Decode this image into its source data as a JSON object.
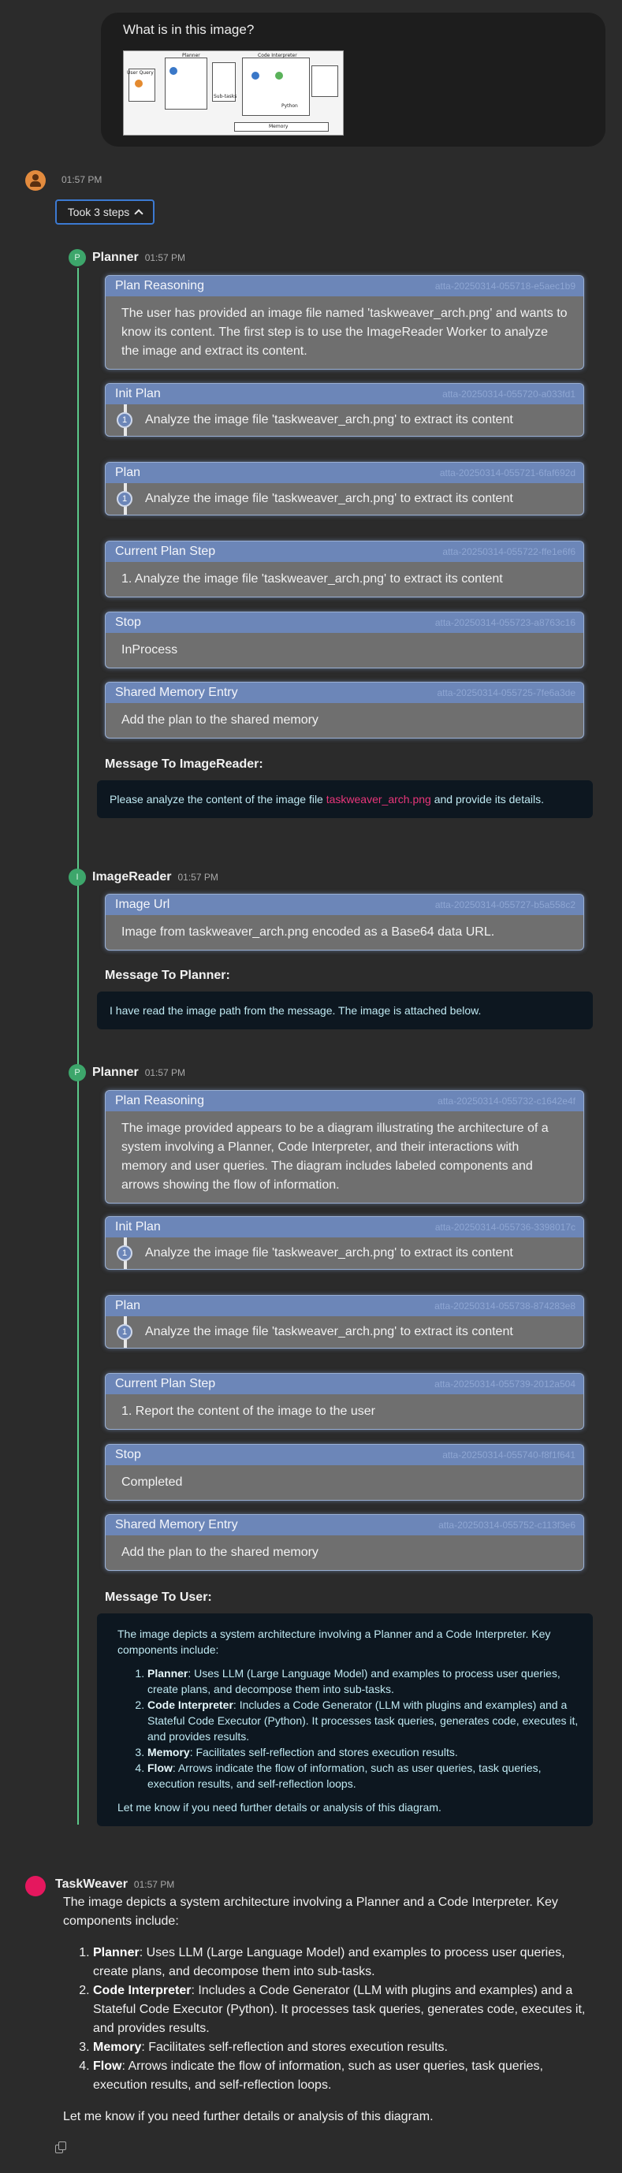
{
  "user_message": {
    "question": "What is in this image?",
    "thumb_labels": [
      "Planner",
      "Code Interpreter",
      "User Query",
      "Memory",
      "Examples",
      "Sub-tasks",
      "Python"
    ]
  },
  "bot": {
    "time": "01:57 PM",
    "steps_button": "Took 3 steps"
  },
  "round1": {
    "planner": {
      "initial": "P",
      "name": "Planner",
      "time": "01:57 PM",
      "cards": [
        {
          "title": "Plan Reasoning",
          "id": "atta-20250314-055718-e5aec1b9",
          "text": "The user has provided an image file named 'taskweaver_arch.png' and wants to know its content. The first step is to use the ImageReader Worker to analyze the image and extract its content."
        },
        {
          "title": "Init Plan",
          "id": "atta-20250314-055720-a033fd1",
          "num": "1",
          "text": "Analyze the image file 'taskweaver_arch.png' to extract its content"
        },
        {
          "title": "Plan",
          "id": "atta-20250314-055721-6faf692d",
          "num": "1",
          "text": "Analyze the image file 'taskweaver_arch.png' to extract its content"
        },
        {
          "title": "Current Plan Step",
          "id": "atta-20250314-055722-ffe1e6f6",
          "text": "1. Analyze the image file 'taskweaver_arch.png' to extract its content"
        },
        {
          "title": "Stop",
          "id": "atta-20250314-055723-a8763c16",
          "text": "InProcess"
        },
        {
          "title": "Shared Memory Entry",
          "id": "atta-20250314-055725-7fe6a3de",
          "text": "Add the plan to the shared memory"
        }
      ],
      "message_to": "Message To ImageReader:",
      "message_pre": "Please analyze the content of the image file ",
      "message_file": "taskweaver_arch.png",
      "message_post": " and provide its details."
    },
    "image_reader": {
      "initial": "I",
      "name": "ImageReader",
      "time": "01:57 PM",
      "card": {
        "title": "Image Url",
        "id": "atta-20250314-055727-b5a558c2",
        "text": "Image from taskweaver_arch.png encoded as a Base64 data URL."
      },
      "message_to": "Message To Planner:",
      "message": "I have read the image path from the message. The image is attached below."
    }
  },
  "round2": {
    "planner": {
      "initial": "P",
      "name": "Planner",
      "time": "01:57 PM",
      "cards": [
        {
          "title": "Plan Reasoning",
          "id": "atta-20250314-055732-c1642e4f",
          "text": "The image provided appears to be a diagram illustrating the architecture of a system involving a Planner, Code Interpreter, and their interactions with memory and user queries. The diagram includes labeled components and arrows showing the flow of information."
        },
        {
          "title": "Init Plan",
          "id": "atta-20250314-055736-3398017c",
          "num": "1",
          "text": "Analyze the image file 'taskweaver_arch.png' to extract its content"
        },
        {
          "title": "Plan",
          "id": "atta-20250314-055738-874283e8",
          "num": "1",
          "text": "Analyze the image file 'taskweaver_arch.png' to extract its content"
        },
        {
          "title": "Current Plan Step",
          "id": "atta-20250314-055739-2012a504",
          "text": "1. Report the content of the image to the user"
        },
        {
          "title": "Stop",
          "id": "atta-20250314-055740-f8f1f641",
          "text": "Completed"
        },
        {
          "title": "Shared Memory Entry",
          "id": "atta-20250314-055752-c113f3e6",
          "text": "Add the plan to the shared memory"
        }
      ],
      "message_to": "Message To User:"
    }
  },
  "summary": {
    "intro": "The image depicts a system architecture involving a Planner and a Code Interpreter. Key components include:",
    "items": [
      {
        "term": "Planner",
        "text": ": Uses LLM (Large Language Model) and examples to process user queries, create plans, and decompose them into sub-tasks."
      },
      {
        "term": "Code Interpreter",
        "text": ": Includes a Code Generator (LLM with plugins and examples) and a Stateful Code Executor (Python). It processes task queries, generates code, executes it, and provides results."
      },
      {
        "term": "Memory",
        "text": ": Facilitates self-reflection and stores execution results."
      },
      {
        "term": "Flow",
        "text": ": Arrows indicate the flow of information, such as user queries, task queries, execution results, and self-reflection loops."
      }
    ],
    "outro": "Let me know if you need further details or analysis of this diagram."
  },
  "final": {
    "name": "TaskWeaver",
    "time": "01:57 PM"
  },
  "colors": {
    "background": "#2b2b2b",
    "card_header": "#6c86b8",
    "card_body": "#6f6f6f",
    "accent_green": "#5cc98a",
    "file_highlight": "#e8367a"
  }
}
